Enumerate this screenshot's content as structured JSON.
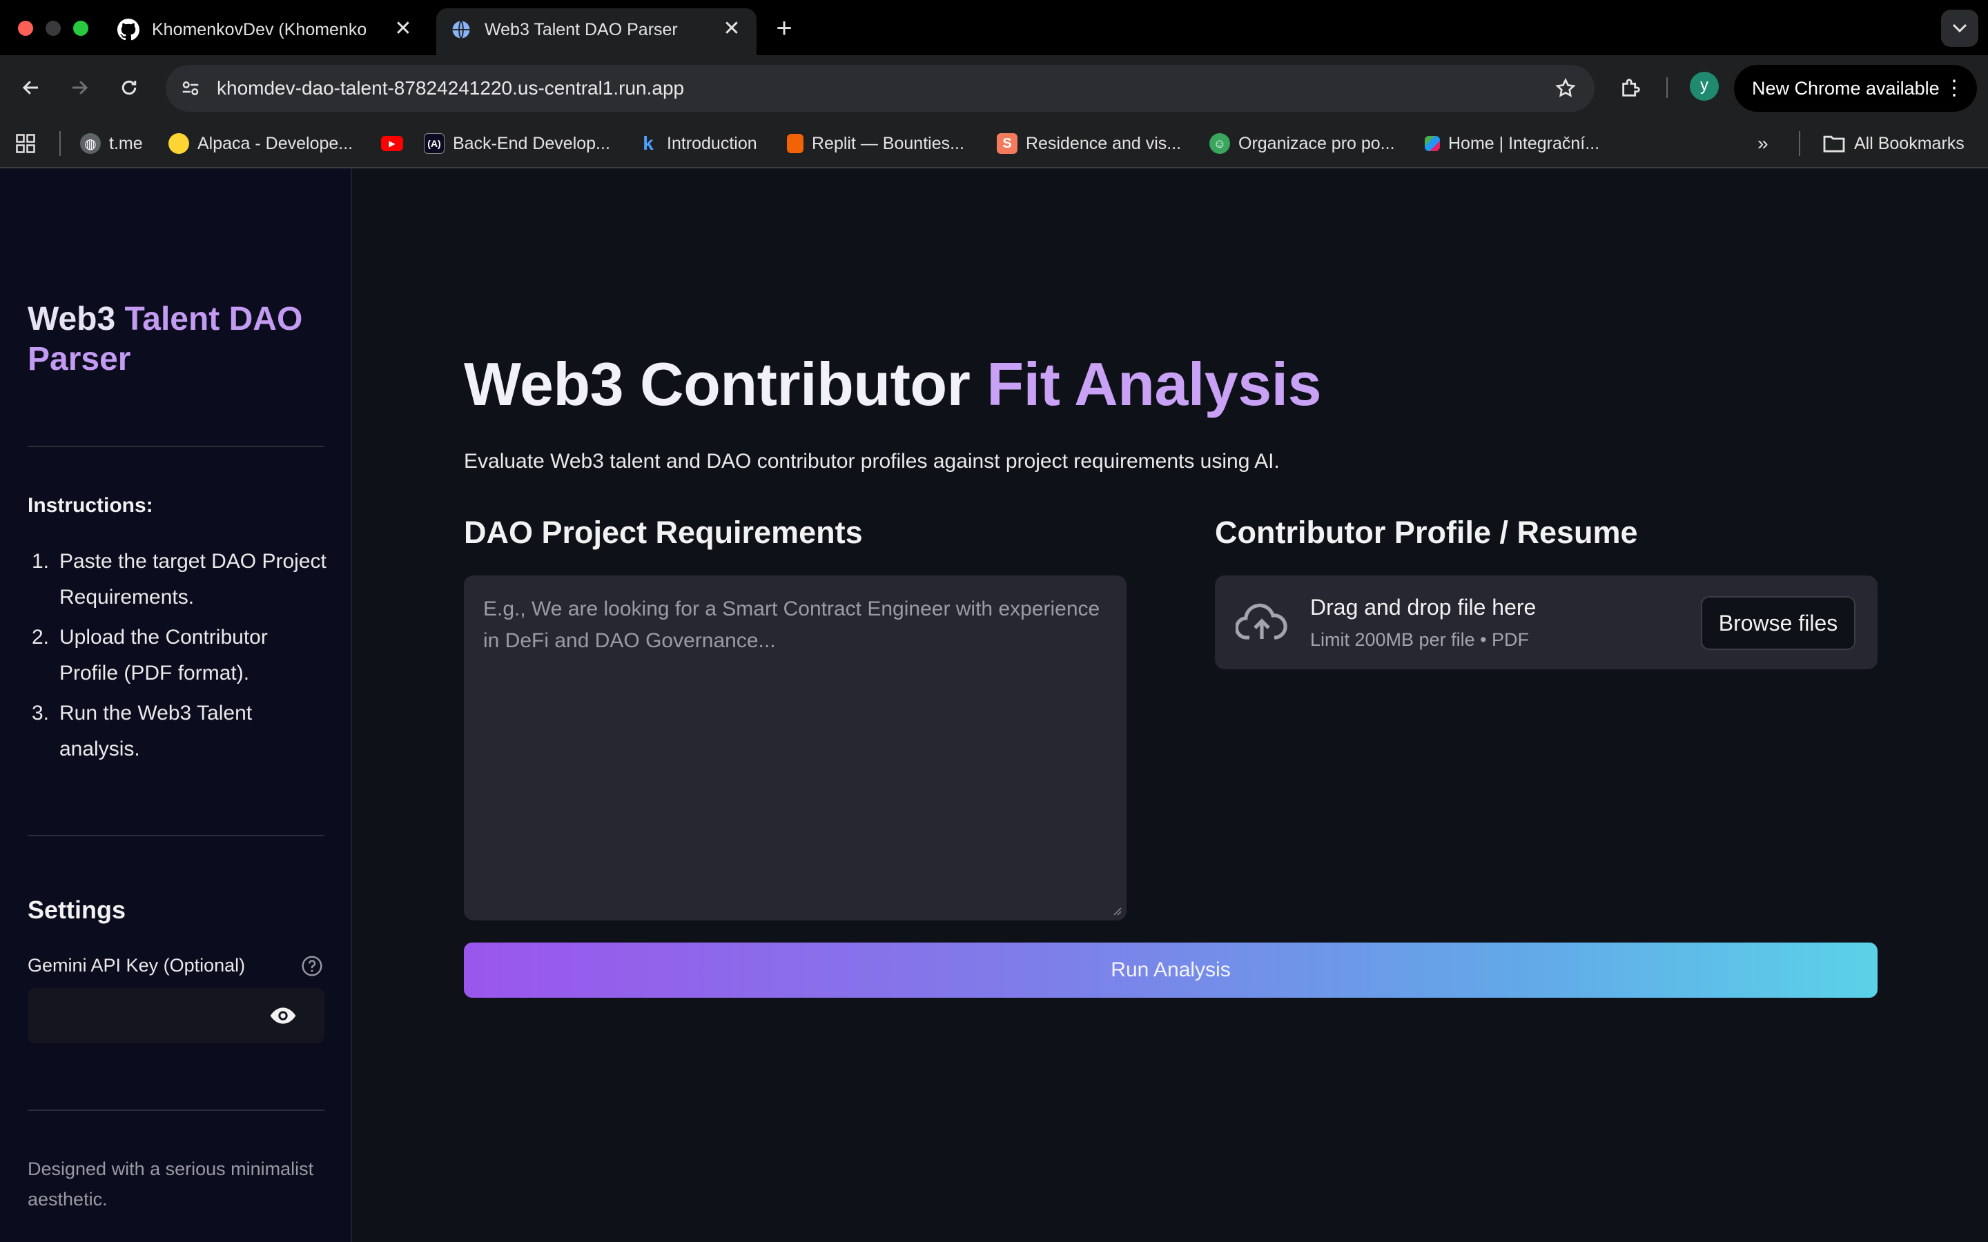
{
  "browser": {
    "tabs": [
      {
        "title": "KhomenkovDev (Khomenkov",
        "active": false,
        "favicon": "github-icon"
      },
      {
        "title": "Web3 Talent DAO Parser",
        "active": true,
        "favicon": "globe-icon"
      }
    ],
    "url": "khomdev-dao-talent-87824241220.us-central1.run.app",
    "profile_initial": "y",
    "update_label": "New Chrome available",
    "bookmarks": [
      {
        "label": "t.me",
        "icon": "globe-icon"
      },
      {
        "label": "Alpaca - Develope...",
        "icon": "alpaca-icon"
      },
      {
        "label": "",
        "icon": "youtube-icon"
      },
      {
        "label": "Back-End Develop...",
        "icon": "freecodecamp-icon"
      },
      {
        "label": "Introduction",
        "icon": "k-icon"
      },
      {
        "label": "Replit — Bounties...",
        "icon": "replit-icon"
      },
      {
        "label": "Residence and vis...",
        "icon": "s-icon"
      },
      {
        "label": "Organizace pro po...",
        "icon": "smiley-icon"
      },
      {
        "label": "Home | Integrační...",
        "icon": "grid-color-icon"
      }
    ],
    "all_bookmarks_label": "All Bookmarks"
  },
  "sidebar": {
    "title_part1": "Web3 ",
    "title_accent": "Talent DAO",
    "title_part2": "Parser",
    "instructions_heading": "Instructions:",
    "instructions": [
      {
        "num": "1.",
        "text": "Paste the target DAO Project Requirements."
      },
      {
        "num": "2.",
        "text": "Upload the Contributor Profile (PDF format)."
      },
      {
        "num": "3.",
        "text": "Run the Web3 Talent analysis."
      }
    ],
    "settings_heading": "Settings",
    "api_key_label": "Gemini API Key (Optional)",
    "api_key_value": "",
    "footer": "Designed with a serious minimalist aesthetic."
  },
  "main": {
    "title_part1": "Web3 Contributor ",
    "title_accent": "Fit Analysis",
    "subtitle": "Evaluate Web3 talent and DAO contributor profiles against project requirements using AI.",
    "requirements_heading": "DAO Project Requirements",
    "requirements_placeholder": "E.g., We are looking for a Smart Contract Engineer with experience in DeFi and DAO Governance...",
    "profile_heading": "Contributor Profile / Resume",
    "dropzone_title": "Drag and drop file here",
    "dropzone_limit": "Limit 200MB per file • PDF",
    "browse_label": "Browse files",
    "run_label": "Run Analysis"
  },
  "colors": {
    "accent_purple": "#c9a2f5",
    "background": "#0e1117",
    "sidebar": "#0b0c1d",
    "gradient_start": "#9b56ec",
    "gradient_end": "#5bd2e8"
  }
}
